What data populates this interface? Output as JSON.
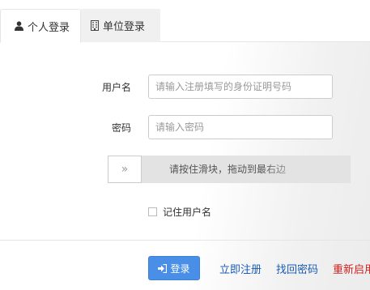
{
  "tabs": [
    {
      "label": "个人登录",
      "icon": "user-icon",
      "active": true
    },
    {
      "label": "单位登录",
      "icon": "building-icon",
      "active": false
    }
  ],
  "form": {
    "username_label": "用户名",
    "username_placeholder": "请输入注册填写的身份证明号码",
    "username_value": "",
    "password_label": "密码",
    "password_placeholder": "请输入密码",
    "password_value": "",
    "slider_handle": "»",
    "slider_text": "请按住滑块，拖动到最右边",
    "slider_progress": 0,
    "remember_label": "记住用户名",
    "remember_checked": false
  },
  "actions": {
    "login_label": "登录",
    "register_label": "立即注册",
    "recover_label": "找回密码",
    "reactivate_label": "重新启用"
  },
  "colors": {
    "primary": "#4a8fe7",
    "link": "#1a5bb4",
    "danger": "#d42020"
  }
}
